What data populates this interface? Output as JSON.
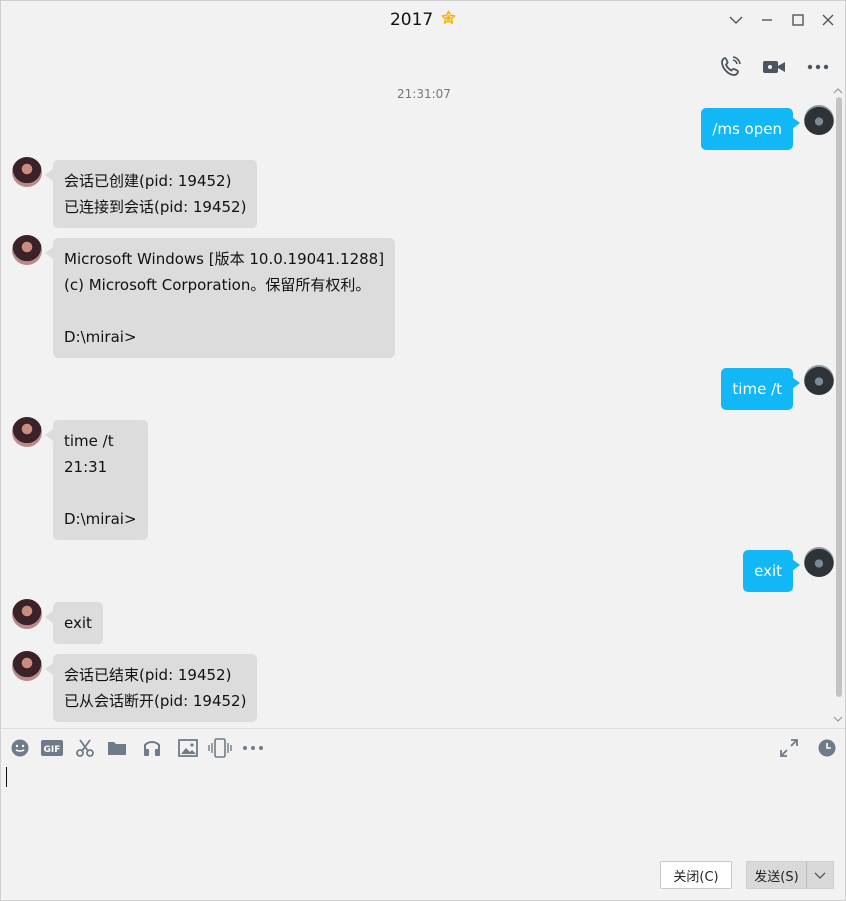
{
  "window": {
    "title": "2017",
    "star_icon": "star-icon",
    "controls": [
      "chevron-down-icon",
      "minimize-icon",
      "maximize-icon",
      "close-icon"
    ]
  },
  "callbar": {
    "icons": [
      "phone-call-icon",
      "video-call-icon",
      "more-icon"
    ]
  },
  "chat": {
    "timestamp": "21:31:07",
    "messages": [
      {
        "side": "out",
        "text": "/ms open"
      },
      {
        "side": "in",
        "text": "会话已创建(pid: 19452)\n已连接到会话(pid: 19452)"
      },
      {
        "side": "in",
        "text": "Microsoft Windows [版本 10.0.19041.1288]\n(c) Microsoft Corporation。保留所有权利。\n\nD:\\mirai>"
      },
      {
        "side": "out",
        "text": "time /t"
      },
      {
        "side": "in",
        "text": "time /t\n21:31\n\nD:\\mirai>"
      },
      {
        "side": "out",
        "text": "exit"
      },
      {
        "side": "in",
        "text": "exit"
      },
      {
        "side": "in",
        "text": "会话已结束(pid: 19452)\n已从会话断开(pid: 19452)"
      }
    ]
  },
  "toolbar": {
    "icons": [
      "emoji-icon",
      "gif-icon",
      "screenshot-scissors-icon",
      "folder-icon",
      "music-icon",
      "image-icon",
      "shake-icon",
      "more-icon"
    ],
    "right_icons": [
      "expand-icon",
      "history-clock-icon"
    ]
  },
  "input": {
    "value": ""
  },
  "buttons": {
    "close_label": "关闭(C)",
    "send_label": "发送(S)"
  },
  "colors": {
    "outgoing_bubble": "#12b7f5",
    "incoming_bubble": "#dcdcdc",
    "star": "#f5b800"
  }
}
